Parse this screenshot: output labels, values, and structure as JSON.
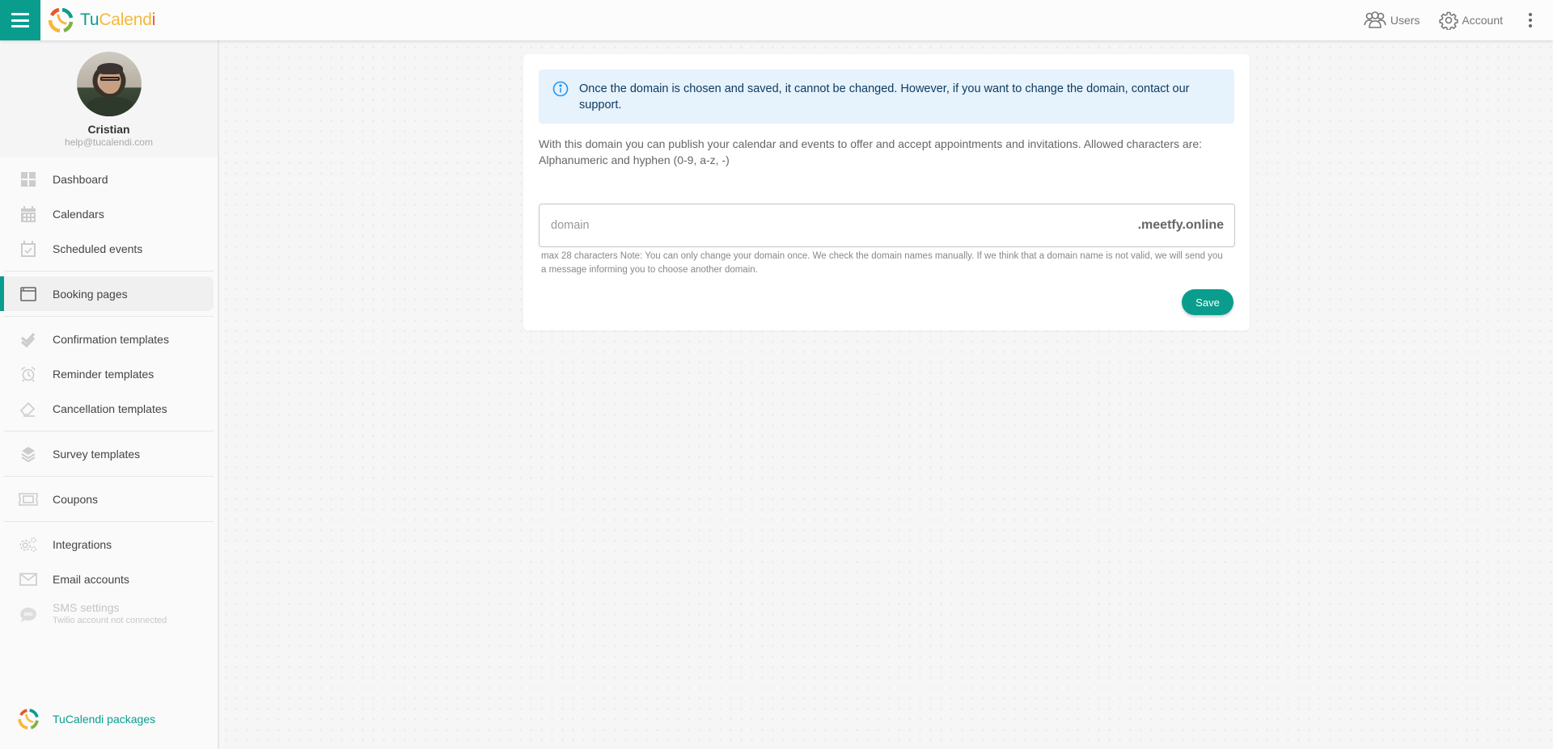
{
  "app": {
    "brand": {
      "part1": "Tu",
      "part2": "Calend",
      "part3": "i"
    },
    "colors": {
      "accent": "#0a9d8e",
      "brand_orange": "#f7b73a",
      "brand_red": "#e9552b",
      "info_bg": "#e6f2fc",
      "info_text": "#0d3c61"
    }
  },
  "header": {
    "menu_icon": "hamburger-icon",
    "links": [
      {
        "label": "Users",
        "icon": "users-icon"
      },
      {
        "label": "Account",
        "icon": "gear-icon"
      }
    ],
    "more_icon": "kebab-menu-icon"
  },
  "profile": {
    "name": "Cristian",
    "email": "help@tucalendi.com"
  },
  "sidebar": {
    "groups": [
      [
        {
          "label": "Dashboard",
          "icon": "dashboard-icon"
        },
        {
          "label": "Calendars",
          "icon": "calendar-icon"
        },
        {
          "label": "Scheduled events",
          "icon": "calendar-check-icon"
        }
      ],
      [
        {
          "label": "Booking pages",
          "icon": "browser-window-icon",
          "active": true
        }
      ],
      [
        {
          "label": "Confirmation templates",
          "icon": "double-check-icon"
        },
        {
          "label": "Reminder templates",
          "icon": "alarm-clock-icon"
        },
        {
          "label": "Cancellation templates",
          "icon": "eraser-icon"
        }
      ],
      [
        {
          "label": "Survey templates",
          "icon": "layers-icon"
        }
      ],
      [
        {
          "label": "Coupons",
          "icon": "ticket-icon"
        }
      ],
      [
        {
          "label": "Integrations",
          "icon": "gears-icon"
        },
        {
          "label": "Email accounts",
          "icon": "envelope-icon"
        },
        {
          "label": "SMS settings",
          "sublabel": "Twilio account not connected",
          "icon": "sms-bubble-icon",
          "disabled": true
        }
      ]
    ],
    "packages_label": "TuCalendi packages"
  },
  "main": {
    "alert_text": "Once the domain is chosen and saved, it cannot be changed. However, if you want to change the domain, contact our support.",
    "description": "With this domain you can publish your calendar and events to offer and accept appointments and invitations. Allowed characters are: Alphanumeric and hyphen (0-9, a-z, -)",
    "domain_input": {
      "value": "",
      "placeholder": "domain",
      "suffix": ".meetfy.online"
    },
    "helper_text": "max 28 characters Note: You can only change your domain once. We check the domain names manually. If we think that a domain name is not valid, we will send you a message informing you to choose another domain.",
    "save_label": "Save"
  }
}
